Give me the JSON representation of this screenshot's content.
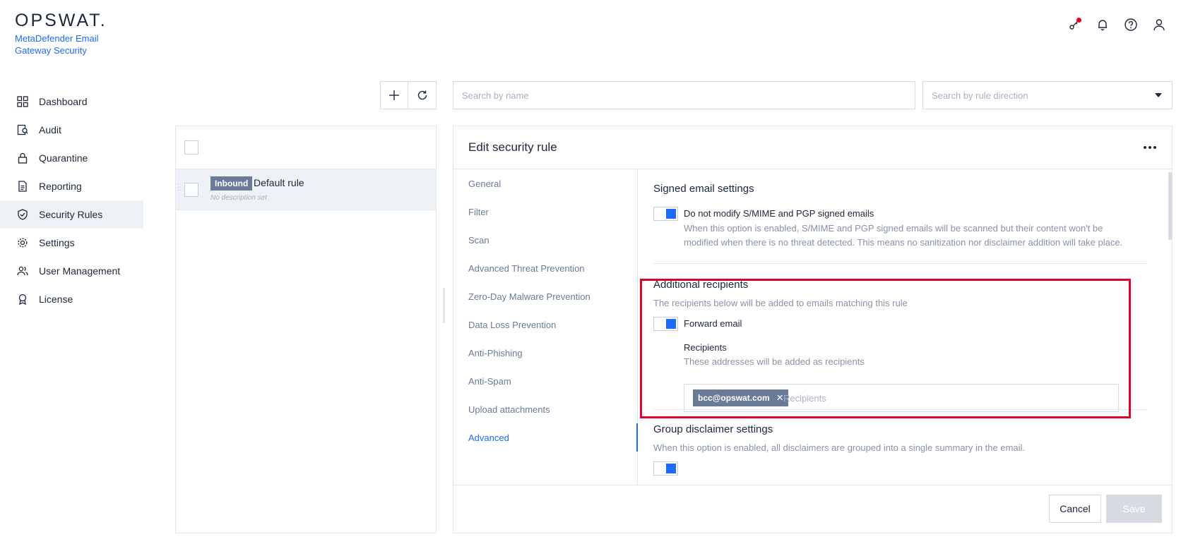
{
  "logo": {
    "wordmark": "OPSWAT.",
    "product_line1": "MetaDefender Email",
    "product_line2": "Gateway Security"
  },
  "top_icons": [
    "key-icon",
    "bell-icon",
    "help-icon",
    "user-icon"
  ],
  "sidebar": {
    "items": [
      {
        "label": "Dashboard",
        "icon": "dashboard-icon"
      },
      {
        "label": "Audit",
        "icon": "audit-icon"
      },
      {
        "label": "Quarantine",
        "icon": "lock-icon"
      },
      {
        "label": "Reporting",
        "icon": "document-icon"
      },
      {
        "label": "Security Rules",
        "icon": "shield-check-icon",
        "active": true
      },
      {
        "label": "Settings",
        "icon": "gear-icon"
      },
      {
        "label": "User Management",
        "icon": "users-icon"
      },
      {
        "label": "License",
        "icon": "award-icon"
      }
    ]
  },
  "rules_list": {
    "rules": [
      {
        "direction": "Inbound",
        "name": "Default rule",
        "description": "No description set"
      }
    ]
  },
  "search": {
    "name_placeholder": "Search by name",
    "direction_placeholder": "Search by rule direction"
  },
  "edit": {
    "title": "Edit security rule",
    "tabs": [
      "General",
      "Filter",
      "Scan",
      "Advanced Threat Prevention",
      "Zero-Day Malware Prevention",
      "Data Loss Prevention",
      "Anti-Phishing",
      "Anti-Spam",
      "Upload attachments",
      "Advanced"
    ],
    "active_tab": "Advanced",
    "signed": {
      "title": "Signed email settings",
      "option_label": "Do not modify S/MIME and PGP signed emails",
      "option_desc_line1": "When this option is enabled, S/MIME and PGP signed emails will be scanned but their content won't be",
      "option_desc_line2": "modified when there is no threat detected. This means no sanitization nor disclaimer addition will take place.",
      "enabled": true
    },
    "additional": {
      "title": "Additional recipients",
      "desc": "The recipients below will be added to emails matching this rule",
      "forward_label": "Forward email",
      "forward_enabled": true,
      "recipients_title": "Recipients",
      "recipients_desc": "These addresses will be added as recipients",
      "recipients": [
        "bcc@opswat.com"
      ],
      "recipients_placeholder": "Recipients"
    },
    "group": {
      "title": "Group disclaimer settings",
      "desc": "When this option is enabled, all disclaimers are grouped into a single summary in the email."
    },
    "cancel_label": "Cancel",
    "save_label": "Save"
  },
  "colors": {
    "accent": "#1d6bfc",
    "highlight": "#e4002b",
    "badge": "#6a7b97"
  }
}
